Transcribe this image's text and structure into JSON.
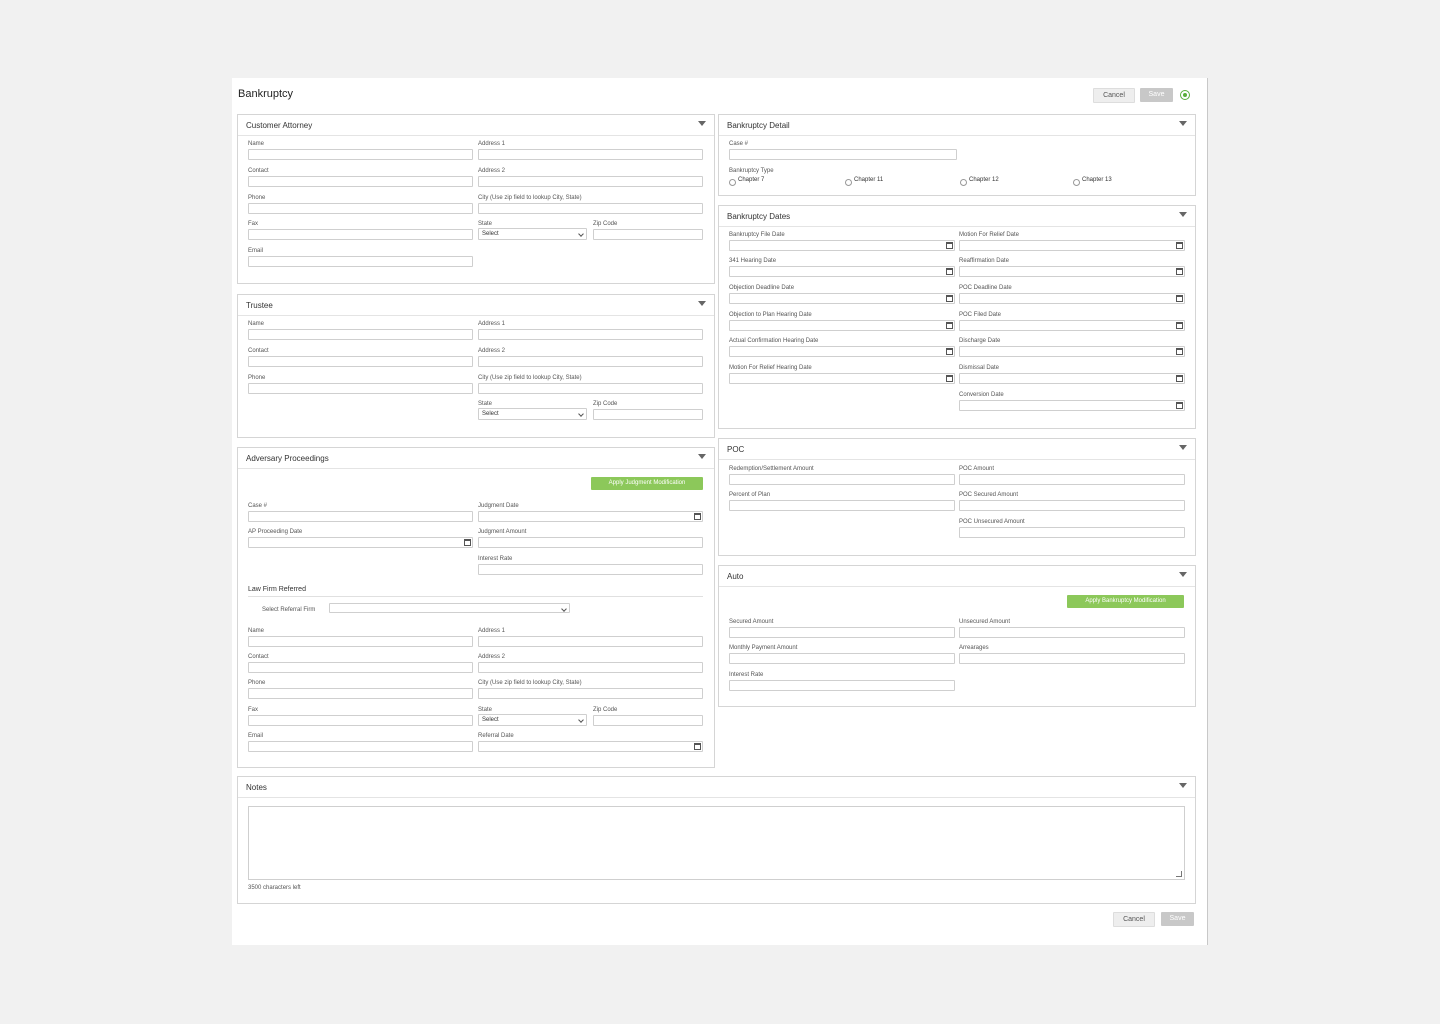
{
  "page": {
    "title": "Bankruptcy",
    "cancel_label": "Cancel",
    "save_label": "Save",
    "help_icon": "help-circle-icon"
  },
  "customer_attorney": {
    "title": "Customer Attorney",
    "name": "Name",
    "address1": "Address 1",
    "contact": "Contact",
    "address2": "Address 2",
    "phone": "Phone",
    "city": "City (Use zip field to lookup City, State)",
    "fax": "Fax",
    "state": "State",
    "state_value": "Select",
    "zip": "Zip Code",
    "email": "Email"
  },
  "trustee": {
    "title": "Trustee",
    "name": "Name",
    "address1": "Address 1",
    "contact": "Contact",
    "address2": "Address 2",
    "phone": "Phone",
    "city": "City (Use zip field to lookup City, State)",
    "state": "State",
    "state_value": "Select",
    "zip": "Zip Code"
  },
  "adversary": {
    "title": "Adversary Proceedings",
    "apply_button": "Apply Judgment Modification",
    "case": "Case #",
    "judgment_date": "Judgment Date",
    "ap_date": "AP Proceeding Date",
    "judgment_amount": "Judgment Amount",
    "interest_rate": "Interest Rate",
    "law_firm_title": "Law Firm Referred",
    "select_firm": "Select Referral Firm",
    "name": "Name",
    "address1": "Address 1",
    "contact": "Contact",
    "address2": "Address 2",
    "phone": "Phone",
    "city": "City (Use zip field to lookup City, State)",
    "fax": "Fax",
    "state": "State",
    "state_value": "Select",
    "zip": "Zip Code",
    "email": "Email",
    "referral_date": "Referral Date"
  },
  "detail": {
    "title": "Bankruptcy Detail",
    "case": "Case #",
    "type_label": "Bankruptcy Type",
    "types": [
      "Chapter 7",
      "Chapter 11",
      "Chapter 12",
      "Chapter 13"
    ]
  },
  "dates": {
    "title": "Bankruptcy Dates",
    "left": [
      "Bankruptcy File Date",
      "341 Hearing Date",
      "Objection Deadline Date",
      "Objection to Plan Hearing Date",
      "Actual Confirmation Hearing Date",
      "Motion For Relief Hearing Date"
    ],
    "right": [
      "Motion For Relief Date",
      "Reaffirmation Date",
      "POC Deadline Date",
      "POC Filed Date",
      "Discharge Date",
      "Dismissal Date",
      "Conversion Date"
    ]
  },
  "poc": {
    "title": "POC",
    "redemption": "Redemption/Settlement Amount",
    "percent": "Percent of Plan",
    "poc_amount": "POC Amount",
    "poc_secured": "POC Secured Amount",
    "poc_unsecured": "POC Unsecured Amount"
  },
  "auto": {
    "title": "Auto",
    "apply_button": "Apply Bankruptcy Modification",
    "secured": "Secured Amount",
    "unsecured": "Unsecured Amount",
    "monthly": "Monthly Payment Amount",
    "arrearages": "Arrearages",
    "interest_rate": "Interest Rate"
  },
  "notes": {
    "title": "Notes",
    "chars_left": "3500 characters left"
  },
  "colors": {
    "green": "#8cc85a",
    "save_disabled": "#c8c8c8"
  }
}
